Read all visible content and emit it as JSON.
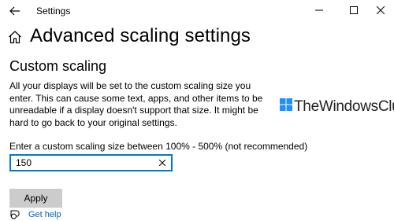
{
  "window": {
    "title": "Settings",
    "controls": [
      "minimize",
      "maximize",
      "close"
    ]
  },
  "header": {
    "title": "Advanced scaling settings"
  },
  "section": {
    "title": "Custom scaling",
    "description": "All your displays will be set to the custom scaling size you enter. This can cause some text, apps, and other items to be unreadable if a display doesn't support that size. It might be hard to go back to your original settings."
  },
  "input": {
    "label": "Enter a custom scaling size between 100% - 500% (not recommended)",
    "value": "150"
  },
  "apply_label": "Apply",
  "help": {
    "label": "Get help"
  },
  "watermark": {
    "text": "TheWindowsClub"
  },
  "colors": {
    "accent": "#0078d4",
    "button_bg": "#cccccc",
    "link": "#0063b1"
  },
  "icons": [
    "back-arrow-icon",
    "home-icon",
    "minimize-icon",
    "maximize-icon",
    "close-icon",
    "clear-icon",
    "help-icon"
  ]
}
